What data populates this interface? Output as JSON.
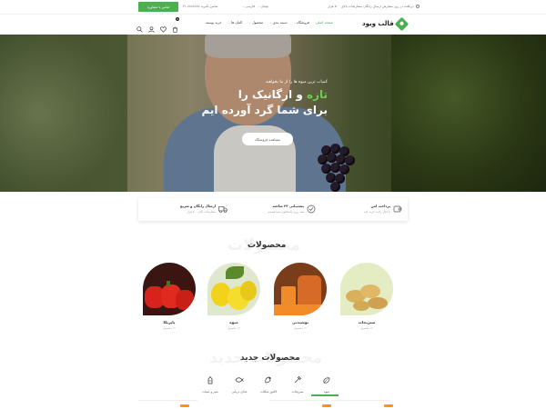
{
  "topbar": {
    "cta_label": "تماس با مشاوره",
    "phone": "۰۲۱-۸۸۸۸۸۸۸ تماس بگیرید",
    "language": "فارسی",
    "currency": "تومان",
    "shipping_note": "ارسال رایگان سفارشات بالای ۵۰۰ هزار",
    "track_order": "دریافت در روز سفارش"
  },
  "header": {
    "logo_text": "قالب ویود",
    "nav": [
      {
        "label": "صفحه اصلی",
        "active": true,
        "has_dropdown": false
      },
      {
        "label": "فروشگاه",
        "active": false,
        "has_dropdown": true
      },
      {
        "label": "دسته بندی",
        "active": false,
        "has_dropdown": true
      },
      {
        "label": "محصول",
        "active": false,
        "has_dropdown": true
      },
      {
        "label": "المان ها",
        "active": false,
        "has_dropdown": true
      },
      {
        "label": "خرید پوسته",
        "active": false,
        "has_dropdown": false
      }
    ],
    "cart_count": "0",
    "accent_color": "#4caf50"
  },
  "hero": {
    "subtitle": "کمیاب ترین میوه ها را از ما بخواهید",
    "title_green": "تازه",
    "title_rest": " و ارگانیک را",
    "title_line2": "برای شما گرد آورده ایم",
    "button_label": "مشاهده فروشگاه"
  },
  "features": [
    {
      "title": "پرداخت امن",
      "desc": "با خیال راحت خرید کنید",
      "icon": "secure-payment-icon"
    },
    {
      "title": "پشتیبانی ۲۴ ساعته",
      "desc": "همه روزه پاسخگوی شما هستیم",
      "icon": "support-icon"
    },
    {
      "title": "ارسال رایگان و سریع",
      "desc": "سفارشات بالای ۵۰۰ هزار",
      "icon": "delivery-truck-icon"
    }
  ],
  "categories_section": {
    "ghost_title": "محصولات",
    "title": "محصولات",
    "items": [
      {
        "name": "سبزیجات",
        "count": "۱۲ محصول"
      },
      {
        "name": "نوشیدنی",
        "count": "۱۲ محصول"
      },
      {
        "name": "میوه",
        "count": "۱۲ محصول"
      },
      {
        "name": "پاپریکا",
        "count": "۱۲ محصول"
      }
    ]
  },
  "new_products": {
    "ghost_title": "محصولات جدید",
    "title": "محصولات جدید",
    "tabs": [
      {
        "label": "میوه",
        "icon": "fruit-icon",
        "active": true
      },
      {
        "label": "سبزیجات",
        "icon": "vegetable-icon",
        "active": false
      },
      {
        "label": "لاکتوز شکلات",
        "icon": "chocolate-icon",
        "active": false
      },
      {
        "label": "غذای دریایی",
        "icon": "seafood-icon",
        "active": false
      },
      {
        "label": "شیر و لبنیات",
        "icon": "dairy-icon",
        "active": false
      }
    ]
  }
}
